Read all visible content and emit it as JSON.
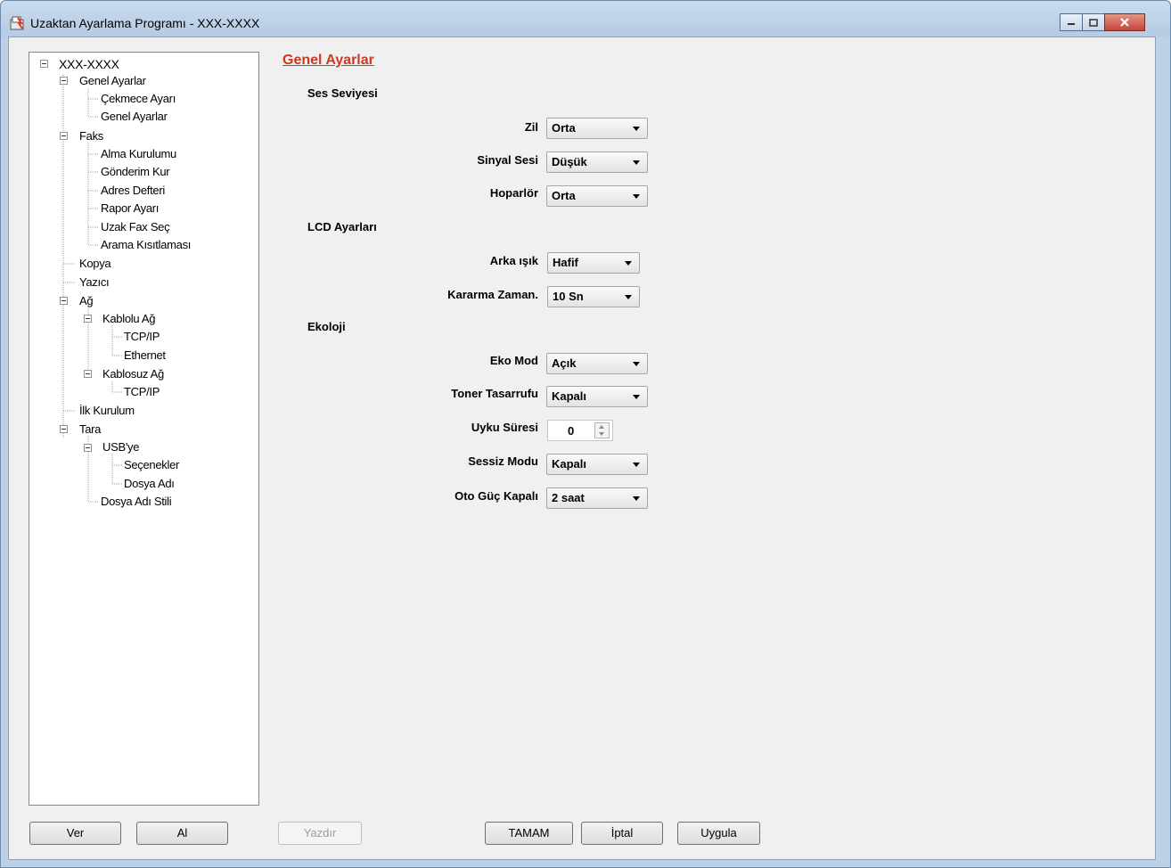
{
  "window": {
    "title": "Uzaktan Ayarlama Programı - XXX-XXXX"
  },
  "tree": {
    "nodes": [
      {
        "label": "XXX-XXXX"
      },
      {
        "label": "Genel Ayarlar"
      },
      {
        "label": "Çekmece Ayarı"
      },
      {
        "label": "Genel Ayarlar"
      },
      {
        "label": "Faks"
      },
      {
        "label": "Alma Kurulumu"
      },
      {
        "label": "Gönderim Kur"
      },
      {
        "label": "Adres Defteri"
      },
      {
        "label": "Rapor Ayarı"
      },
      {
        "label": "Uzak Fax Seç"
      },
      {
        "label": "Arama Kısıtlaması"
      },
      {
        "label": "Kopya"
      },
      {
        "label": "Yazıcı"
      },
      {
        "label": "Ağ"
      },
      {
        "label": "Kablolu Ağ"
      },
      {
        "label": "TCP/IP"
      },
      {
        "label": "Ethernet"
      },
      {
        "label": "Kablosuz Ağ"
      },
      {
        "label": "TCP/IP"
      },
      {
        "label": "İlk Kurulum"
      },
      {
        "label": "Tara"
      },
      {
        "label": "USB'ye"
      },
      {
        "label": "Seçenekler"
      },
      {
        "label": "Dosya Adı"
      },
      {
        "label": "Dosya Adı Stili"
      }
    ]
  },
  "main": {
    "section_title": "Genel Ayarlar",
    "groups": {
      "ses": "Ses Seviyesi",
      "lcd": "LCD Ayarları",
      "ekoloji": "Ekoloji"
    },
    "fields": {
      "zil": {
        "label": "Zil",
        "value": "Orta"
      },
      "sinyal": {
        "label": "Sinyal Sesi",
        "value": "Düşük"
      },
      "hoparlor": {
        "label": "Hoparlör",
        "value": "Orta"
      },
      "arka_isik": {
        "label": "Arka ışık",
        "value": "Hafif"
      },
      "karartma": {
        "label": "Kararma Zaman.",
        "value": "10 Sn"
      },
      "eko_mod": {
        "label": "Eko Mod",
        "value": "Açık"
      },
      "toner": {
        "label": "Toner Tasarrufu",
        "value": "Kapalı"
      },
      "uyku": {
        "label": "Uyku Süresi",
        "value": "0"
      },
      "sessiz": {
        "label": "Sessiz Modu",
        "value": "Kapalı"
      },
      "oto_guc": {
        "label": "Oto Güç Kapalı",
        "value": "2 saat"
      }
    }
  },
  "buttons": {
    "ver": "Ver",
    "al": "Al",
    "yazdir": "Yazdır",
    "tamam": "TAMAM",
    "iptal": "İptal",
    "uygula": "Uygula"
  },
  "colors": {
    "section_title": "#d0371e",
    "close_button": "#c3443a",
    "frame": "#bcd0e6"
  }
}
